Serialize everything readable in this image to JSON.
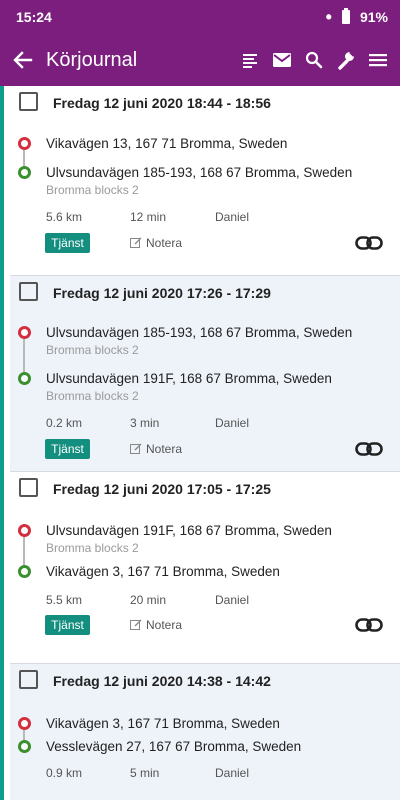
{
  "status": {
    "time": "15:24",
    "dot": "•",
    "battery": "91%"
  },
  "appbar": {
    "title": "Körjournal",
    "actions": [
      "list-icon",
      "mail-icon",
      "search-icon",
      "wrench-icon",
      "menu-icon"
    ]
  },
  "trips": [
    {
      "header": "Fredag 12 juni 2020 18:44 - 18:56",
      "from": "Vikavägen 13, 167 71 Bromma, Sweden",
      "from_sub": "",
      "to": "Ulvsundavägen 185-193, 168 67 Bromma, Sweden",
      "to_sub": "Bromma blocks 2",
      "distance": "5.6 km",
      "duration": "12 min",
      "driver": "Daniel",
      "badge": "Tjänst",
      "note": "Notera"
    },
    {
      "header": "Fredag 12 juni 2020 17:26 - 17:29",
      "from": "Ulvsundavägen 185-193, 168 67 Bromma, Sweden",
      "from_sub": "Bromma blocks 2",
      "to": "Ulvsundavägen 191F, 168 67 Bromma, Sweden",
      "to_sub": "Bromma blocks 2",
      "distance": "0.2 km",
      "duration": "3 min",
      "driver": "Daniel",
      "badge": "Tjänst",
      "note": "Notera"
    },
    {
      "header": "Fredag 12 juni 2020 17:05 - 17:25",
      "from": "Ulvsundavägen 191F, 168 67 Bromma, Sweden",
      "from_sub": "Bromma blocks 2",
      "to": "Vikavägen 3, 167 71 Bromma, Sweden",
      "to_sub": "",
      "distance": "5.5 km",
      "duration": "20 min",
      "driver": "Daniel",
      "badge": "Tjänst",
      "note": "Notera"
    },
    {
      "header": "Fredag 12 juni 2020 14:38 - 14:42",
      "from": "Vikavägen 3, 167 71 Bromma, Sweden",
      "from_sub": "",
      "to": "Vesslevägen 27, 167 67 Bromma, Sweden",
      "to_sub": "",
      "distance": "0.9 km",
      "duration": "5 min",
      "driver": "Daniel",
      "badge": "",
      "note": ""
    }
  ]
}
